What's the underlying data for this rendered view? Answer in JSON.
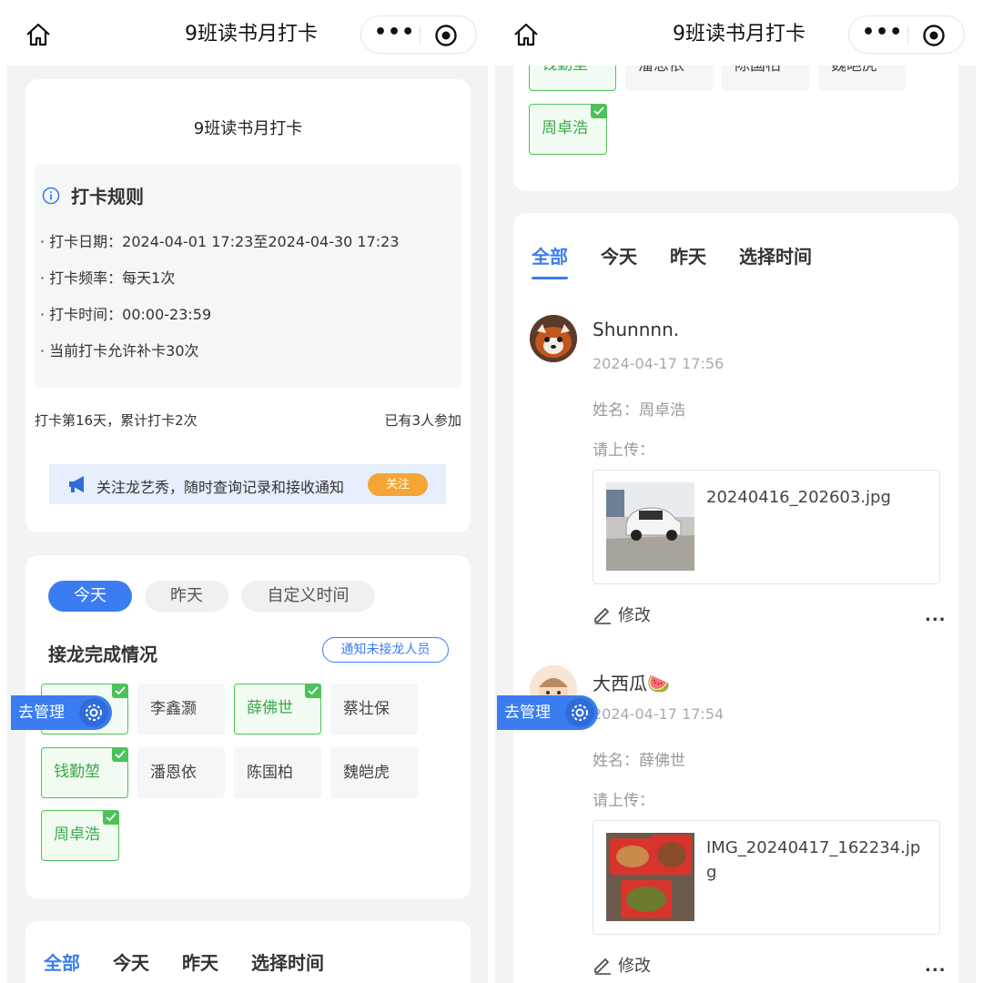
{
  "app": {
    "title": "9班读书月打卡",
    "more_label": "•••"
  },
  "left": {
    "header_card": {
      "title": "9班读书月打卡",
      "rules": {
        "heading": "打卡规则",
        "items": [
          "· 打卡日期：2024-04-01 17:23至2024-04-30 17:23",
          "· 打卡频率：每天1次",
          "· 打卡时间：00:00-23:59",
          "· 当前打卡允许补卡30次"
        ]
      },
      "stats_left": "打卡第16天，累计打卡2次",
      "stats_right": "已有3人参加",
      "follow": {
        "text": "关注龙艺秀，随时查询记录和接收通知",
        "button": "关注"
      }
    },
    "completion_card": {
      "filters": [
        "今天",
        "昨天",
        "自定义时间"
      ],
      "title": "接龙完成情况",
      "notify_button": "通知未接龙人员",
      "members": [
        {
          "name": "",
          "done": true
        },
        {
          "name": "李鑫灏",
          "done": false
        },
        {
          "name": "薛佛世",
          "done": true
        },
        {
          "name": "蔡壮保",
          "done": false
        },
        {
          "name": "钱勤堃",
          "done": true
        },
        {
          "name": "潘恩依",
          "done": false
        },
        {
          "name": "陈国柏",
          "done": false
        },
        {
          "name": "魏皑虎",
          "done": false
        },
        {
          "name": "周卓浩",
          "done": true
        }
      ]
    },
    "manage_button": "去管理",
    "bottom_tabs": [
      "全部",
      "今天",
      "昨天",
      "选择时间"
    ]
  },
  "right": {
    "partial_members": [
      {
        "name": "钱勤堃",
        "done": true
      },
      {
        "name": "潘恩依",
        "done": false
      },
      {
        "name": "陈国柏",
        "done": false
      },
      {
        "name": "魏皑虎",
        "done": false
      },
      {
        "name": "周卓浩",
        "done": true
      }
    ],
    "tabs": [
      "全部",
      "今天",
      "昨天",
      "选择时间"
    ],
    "manage_button": "去管理",
    "posts": [
      {
        "user": "Shunnnn.",
        "time": "2024-04-17 17:56",
        "name_field": "姓名：周卓浩",
        "upload_label": "请上传：",
        "file_name": "20240416_202603.jpg",
        "edit_label": "修改",
        "more": "..."
      },
      {
        "user": "大西瓜🍉",
        "time": "2024-04-17 17:54",
        "name_field": "姓名：薛佛世",
        "upload_label": "请上传：",
        "file_name": "IMG_20240417_162234.jpg",
        "edit_label": "修改",
        "more": "..."
      }
    ]
  },
  "colors": {
    "accent": "#3b7df0",
    "done_green": "#4cc25a",
    "follow_orange": "#f4a535",
    "page_bg": "#f2f3f5"
  }
}
